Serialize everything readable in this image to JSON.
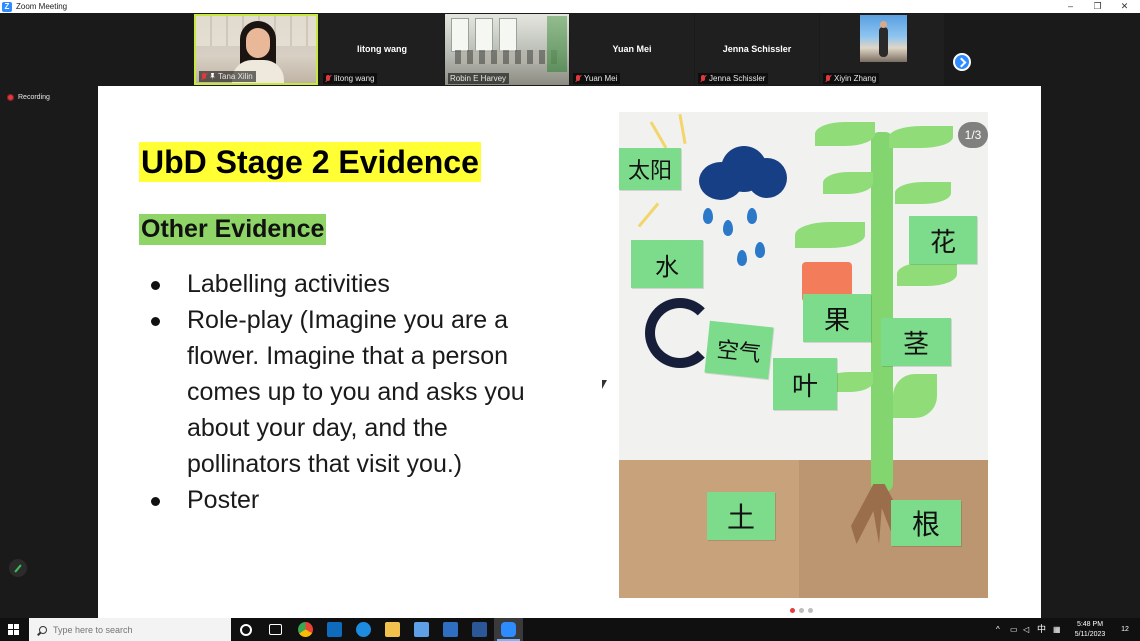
{
  "window": {
    "title": "Zoom Meeting",
    "controls": {
      "minimize": "–",
      "restore": "❐",
      "close": "✕"
    }
  },
  "gallery": {
    "participants": [
      {
        "name": "Tana Xilin",
        "video": "person",
        "active": true,
        "pinned": true
      },
      {
        "name": "litong wang",
        "video": "none",
        "display_name": "litong wang"
      },
      {
        "name": "Robin E Harvey",
        "video": "room"
      },
      {
        "name": "Yuan Mei",
        "video": "none",
        "display_name": "Yuan Mei"
      },
      {
        "name": "Jenna Schissler",
        "video": "none",
        "display_name": "Jenna Schissler"
      },
      {
        "name": "Xiyin Zhang",
        "video": "photo"
      }
    ]
  },
  "recording": {
    "label": "Recording"
  },
  "slide": {
    "heading": "UbD Stage 2 Evidence",
    "subheading": "Other Evidence",
    "bullets": [
      "Labelling activities",
      "Role-play (Imagine you are a flower. Imagine that a person comes up to you and asks you about your day, and the pollinators that visit you.)",
      "Poster"
    ],
    "image": {
      "page_indicator": "1/3",
      "labels": {
        "sun": "太阳",
        "water": "水",
        "air": "空气",
        "fruit": "果",
        "flower": "花",
        "stem": "茎",
        "leaf": "叶",
        "soil": "土",
        "root": "根"
      }
    },
    "pager": {
      "count": 3,
      "current": 1
    }
  },
  "taskbar": {
    "search_placeholder": "Type here to search",
    "tray": {
      "ime": "中",
      "notifications": "12"
    },
    "clock": {
      "time": "5:48 PM",
      "date": "5/11/2023"
    }
  },
  "colors": {
    "heading_highlight": "#ffff33",
    "subheading_highlight": "#8ed466",
    "active_speaker_border": "#c7e93e",
    "zoom_blue": "#2d8cff",
    "recording_red": "#e0393e"
  }
}
